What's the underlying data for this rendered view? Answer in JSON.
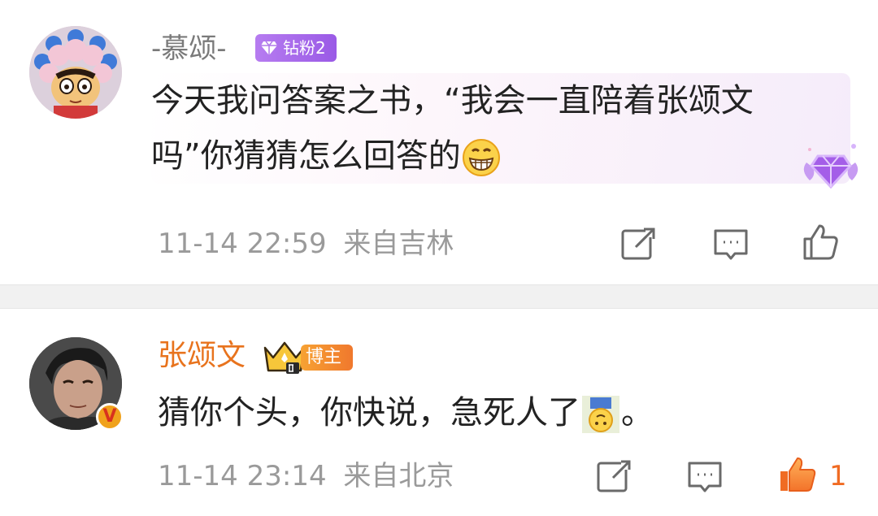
{
  "comments": [
    {
      "username": "-慕颂-",
      "badge": "钻粉2",
      "text_line1": "今天我问答案之书，“我会一直陪着张颂文",
      "text_line2": "吗”你猜猜怎么回答的",
      "emoji": "grin-emoji",
      "time": "11-14 22:59",
      "location": "来自吉林",
      "actions": [
        "share-icon",
        "comment-icon",
        "like-icon"
      ]
    },
    {
      "username": "张颂文",
      "badge": "博主",
      "badge_icon": "crown-icon",
      "verified": "V",
      "text": "猜你个头，你快说，急死人了",
      "text_end": "。",
      "emoji": "upside-down-emoji",
      "time": "11-14 23:14",
      "location": "来自北京",
      "likes": "1",
      "actions": [
        "share-icon",
        "comment-icon",
        "like-icon-active"
      ]
    }
  ],
  "colors": {
    "username_fan": "#7a7a7a",
    "username_author": "#e8731d",
    "meta": "#9a9a9a",
    "like_active": "#f06b23",
    "fan_badge": "#a966ea"
  }
}
